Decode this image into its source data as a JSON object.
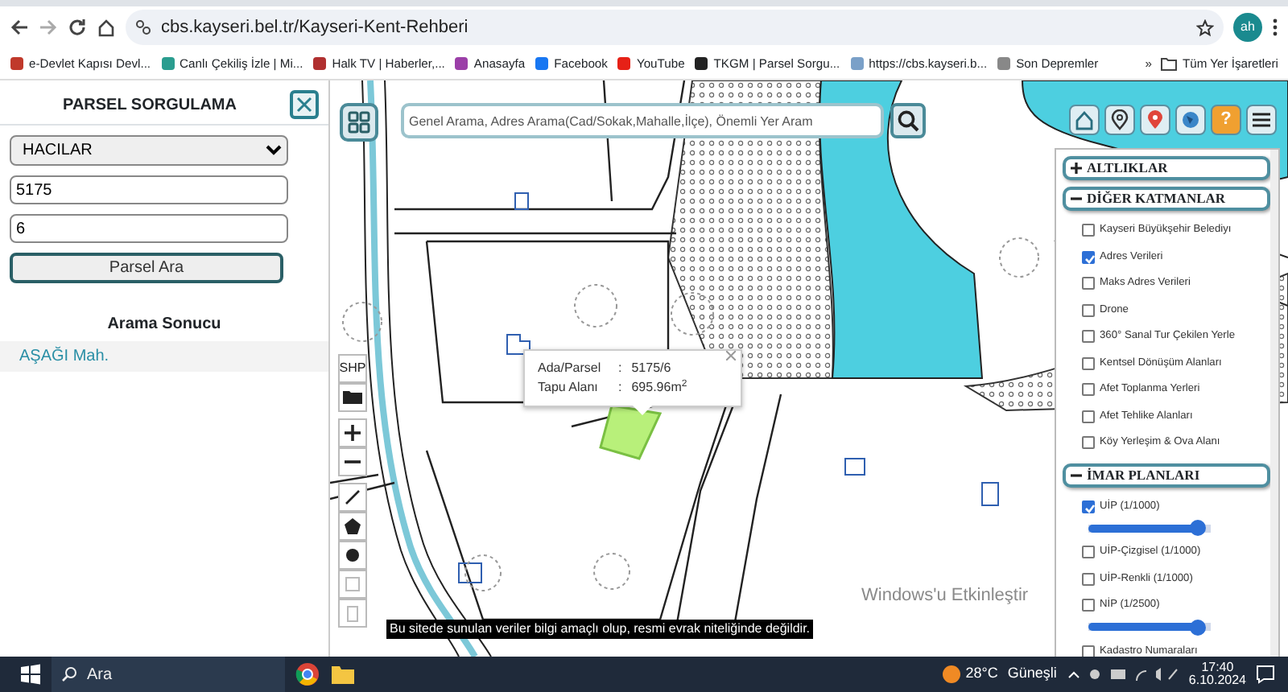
{
  "browser": {
    "url": "cbs.kayseri.bel.tr/Kayseri-Kent-Rehberi",
    "profile": "ah",
    "bookmarks": [
      {
        "label": "e-Devlet Kapısı Devl..."
      },
      {
        "label": "Canlı Çekiliş İzle | Mi..."
      },
      {
        "label": "Halk TV | Haberler,..."
      },
      {
        "label": "Anasayfa"
      },
      {
        "label": "Facebook"
      },
      {
        "label": "YouTube"
      },
      {
        "label": "TKGM | Parsel Sorgu..."
      },
      {
        "label": "https://cbs.kayseri.b..."
      },
      {
        "label": "Son Depremler"
      }
    ],
    "more": "»",
    "all_bookmarks": "Tüm Yer İşaretleri"
  },
  "parcel_panel": {
    "title": "PARSEL SORGULAMA",
    "district": "HACILAR",
    "block": "5175",
    "parcel": "6",
    "search_button": "Parsel Ara",
    "result_title": "Arama Sonucu",
    "results": [
      {
        "label": "AŞAĞI Mah."
      }
    ]
  },
  "map": {
    "search_placeholder": "Genel Arama, Adres Arama(Cad/Sokak,Mahalle,İlçe), Önemli Yer Aram",
    "shp_label": "SHP",
    "popup": {
      "rows": [
        {
          "label": "Ada/Parsel",
          "separator": ":",
          "value": "5175/6"
        },
        {
          "label": "Tapu Alanı",
          "separator": ":",
          "value": "695.96m$^{2}$"
        }
      ]
    },
    "disclaimer": "Bu sitede sunulan veriler bilgi amaçlı olup, resmi evrak niteliğinde değildir.",
    "help_label": "?",
    "activation_notice": "Windows'u Etkinleştir"
  },
  "layers": {
    "sections": [
      {
        "title": "ALTLIKLAR",
        "expanded": false
      },
      {
        "title": "DİĞER KATMANLAR",
        "expanded": true,
        "items": [
          {
            "kind": "checkbox",
            "label": "Kayseri Büyükşehir Belediyı",
            "checked": false
          },
          {
            "kind": "checkbox",
            "label": "Adres Verileri",
            "checked": true
          },
          {
            "kind": "checkbox",
            "label": "Maks Adres Verileri",
            "checked": false
          },
          {
            "kind": "checkbox",
            "label": "Drone",
            "checked": false
          },
          {
            "kind": "checkbox",
            "label": "360° Sanal Tur Çekilen Yerle",
            "checked": false
          },
          {
            "kind": "checkbox",
            "label": "Kentsel Dönüşüm Alanları",
            "checked": false
          },
          {
            "kind": "checkbox",
            "label": "Afet Toplanma Yerleri",
            "checked": false
          },
          {
            "kind": "checkbox",
            "label": "Afet Tehlike Alanları",
            "checked": false
          },
          {
            "kind": "checkbox",
            "label": "Köy Yerleşim & Ova Alanı",
            "checked": false
          }
        ]
      },
      {
        "title": "İMAR PLANLARI",
        "expanded": true,
        "items": [
          {
            "kind": "slider",
            "label": "UİP (1/1000)",
            "checked": true,
            "level": 0.95
          },
          {
            "kind": "checkbox",
            "label": "UİP-Çizgisel (1/1000)",
            "checked": false
          },
          {
            "kind": "checkbox",
            "label": "UİP-Renkli (1/1000)",
            "checked": false
          },
          {
            "kind": "slider",
            "label": "NİP (1/2500)",
            "checked": false,
            "level": 0.95
          },
          {
            "kind": "checkbox",
            "label": "Kadastro Numaraları",
            "checked": false
          }
        ]
      }
    ]
  },
  "taskbar": {
    "search": "Ara",
    "temperature": "28°C",
    "weather": "Güneşli",
    "time": "17:40",
    "date": "6.10.2024"
  }
}
